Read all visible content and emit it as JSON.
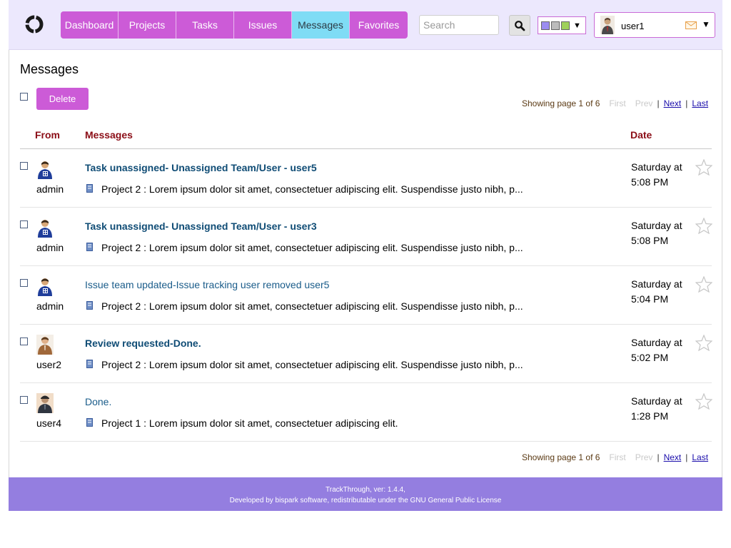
{
  "nav": {
    "items": [
      {
        "label": "Dashboard"
      },
      {
        "label": "Projects"
      },
      {
        "label": "Tasks"
      },
      {
        "label": "Issues"
      },
      {
        "label": "Messages",
        "active": true
      },
      {
        "label": "Favorites"
      }
    ]
  },
  "search": {
    "placeholder": "Search"
  },
  "theme": {
    "swatches": [
      "#9b8cf0",
      "#bcbcbc",
      "#9fd15a"
    ]
  },
  "user": {
    "name": "user1"
  },
  "page": {
    "title": "Messages"
  },
  "toolbar": {
    "delete_label": "Delete"
  },
  "pager": {
    "showing": "Showing page 1 of 6",
    "first": "First",
    "prev": "Prev",
    "next": "Next",
    "last": "Last",
    "sep": "|"
  },
  "table": {
    "headers": {
      "from": "From",
      "messages": "Messages",
      "date": "Date"
    },
    "rows": [
      {
        "from": "admin",
        "avatar": "admin-avatar-icon",
        "subject": "Task unassigned- Unassigned Team/User - user5",
        "unread": true,
        "preview": "Project 2 : Lorem ipsum dolor sit amet, consectetuer adipiscing elit. Suspendisse justo nibh, p...",
        "date_line1": "Saturday at",
        "date_line2": "5:08 PM"
      },
      {
        "from": "admin",
        "avatar": "admin-avatar-icon",
        "subject": "Task unassigned- Unassigned Team/User - user3",
        "unread": true,
        "preview": "Project 2 : Lorem ipsum dolor sit amet, consectetuer adipiscing elit. Suspendisse justo nibh, p...",
        "date_line1": "Saturday at",
        "date_line2": "5:08 PM"
      },
      {
        "from": "admin",
        "avatar": "admin-avatar-icon",
        "subject": "Issue team updated-Issue tracking user removed user5",
        "unread": false,
        "preview": "Project 2 : Lorem ipsum dolor sit amet, consectetuer adipiscing elit. Suspendisse justo nibh, p...",
        "date_line1": "Saturday at",
        "date_line2": "5:04 PM"
      },
      {
        "from": "user2",
        "avatar": "user2-avatar-icon",
        "subject": "Review requested-Done.",
        "unread": true,
        "preview": "Project 2 : Lorem ipsum dolor sit amet, consectetuer adipiscing elit. Suspendisse justo nibh, p...",
        "date_line1": "Saturday at",
        "date_line2": "5:02 PM"
      },
      {
        "from": "user4",
        "avatar": "user4-avatar-icon",
        "subject": "Done.",
        "unread": false,
        "preview": "Project 1 : Lorem ipsum dolor sit amet, consectetuer adipiscing elit.",
        "date_line1": "Saturday at",
        "date_line2": "1:28 PM"
      }
    ]
  },
  "footer": {
    "line1": "TrackThrough, ver: 1.4.4,",
    "line2": "Developed by bispark software, redistributable under the GNU General Public License"
  },
  "colors": {
    "accent": "#cc5bd7",
    "active_tab": "#7fdcf5",
    "header_bg": "#ece8fd",
    "footer_bg": "#947ee0",
    "column_header": "#8b0d16"
  }
}
